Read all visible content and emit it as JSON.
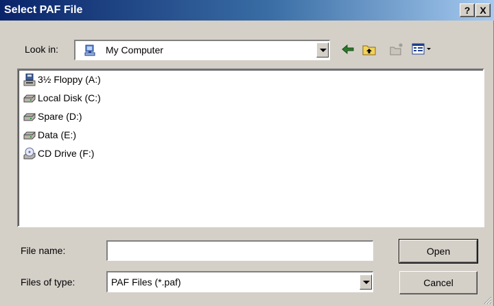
{
  "window": {
    "title": "Select PAF File",
    "help_button": "?",
    "close_button": "X"
  },
  "lookin": {
    "label": "Look in:",
    "value": "My Computer",
    "icon": "my-computer-icon"
  },
  "toolbar": {
    "buttons": [
      "back-icon",
      "up-folder-icon",
      "new-folder-icon",
      "views-menu-icon"
    ]
  },
  "files": [
    {
      "label": "3½ Floppy (A:)",
      "icon": "floppy-drive-icon"
    },
    {
      "label": "Local Disk (C:)",
      "icon": "hard-disk-icon"
    },
    {
      "label": "Spare (D:)",
      "icon": "hard-disk-icon"
    },
    {
      "label": "Data (E:)",
      "icon": "hard-disk-icon"
    },
    {
      "label": "CD Drive (F:)",
      "icon": "cd-drive-icon"
    }
  ],
  "filename": {
    "label": "File name:",
    "value": ""
  },
  "filetype": {
    "label": "Files of type:",
    "value": "PAF Files (*.paf)"
  },
  "buttons": {
    "open": "Open",
    "cancel": "Cancel"
  },
  "colors": {
    "title_gradient_start": "#0a246a",
    "title_gradient_end": "#a6caf0",
    "face": "#d4d0c8"
  }
}
